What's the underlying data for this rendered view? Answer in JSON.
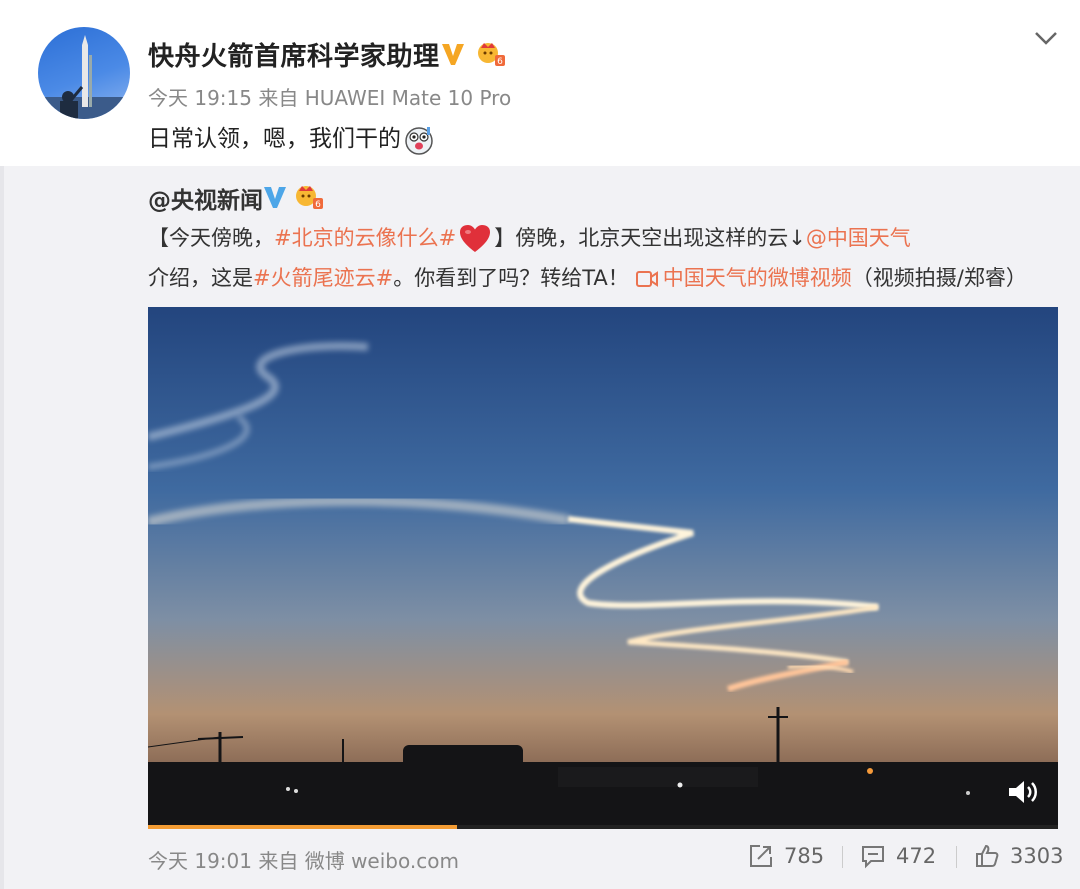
{
  "post": {
    "author": "快舟火箭首席科学家助理",
    "meta": "今天 19:15 来自 HUAWEI Mate 10 Pro",
    "text": "日常认领，嗯，我们干的"
  },
  "repost": {
    "author": "@央视新闻",
    "line1": {
      "p1": "【今天傍晚，",
      "hashtag1": "#北京的云像什么#",
      "p2": "】傍晚，北京天空出现这样的云↓",
      "mention": "@中国天气"
    },
    "line2": {
      "p1": "介绍，这是",
      "hashtag2": "#火箭尾迹云#",
      "p2": "。你看到了吗？转给TA！",
      "video_link": "中国天气的微博视频",
      "p3": "（视频拍摄/郑睿）"
    },
    "video": {
      "progress_pct": 34
    },
    "footer": {
      "meta": "今天 19:01 来自 微博 weibo.com",
      "reposts": "785",
      "comments": "472",
      "likes": "3303"
    }
  },
  "colors": {
    "link": "#eb7350",
    "verified": "#f5a623",
    "repost_bg": "#f2f2f5",
    "progress": "#f39c34"
  },
  "icons": [
    "chevron-down-icon",
    "verified-v-icon",
    "crown-badge-icon",
    "surprised-face-emoji",
    "heart-emoji",
    "video-camera-icon",
    "volume-icon",
    "repost-icon",
    "comment-icon",
    "like-icon"
  ]
}
